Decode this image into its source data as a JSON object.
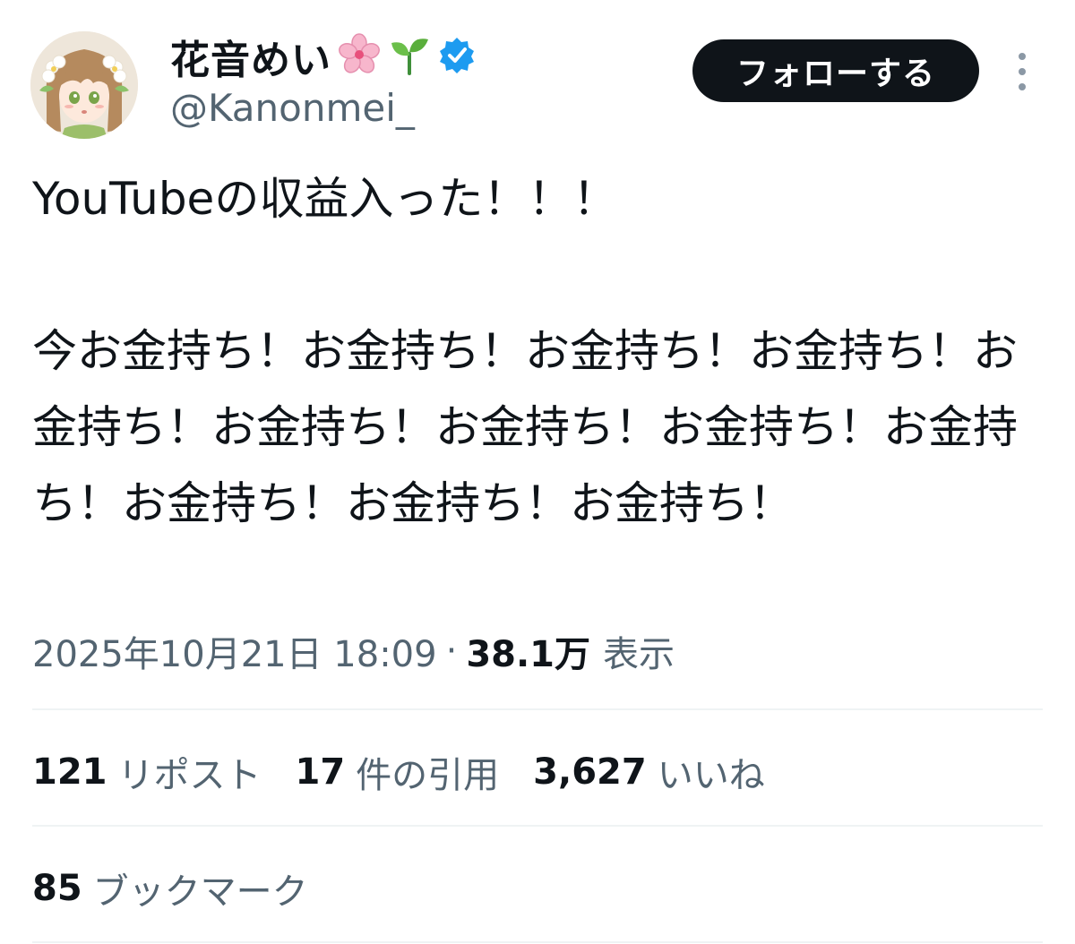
{
  "author": {
    "display_name": "花音めい",
    "handle": "@Kanonmei_",
    "emoji_icons": [
      "cherry-blossom-icon",
      "seedling-icon"
    ],
    "verified": true,
    "verified_color": "#1d9bf0"
  },
  "follow_button": {
    "label": "フォローする"
  },
  "tweet": {
    "text": "YouTubeの収益入った！！！\n\n今お金持ち！お金持ち！お金持ち！お金持ち！お金持ち！お金持ち！お金持ち！お金持ち！お金持ち！お金持ち！お金持ち！お金持ち！"
  },
  "meta": {
    "timestamp": "2025年10月21日 18:09",
    "separator": "·",
    "views_count": "38.1万",
    "views_label": "表示"
  },
  "stats": {
    "reposts": {
      "count": "121",
      "label": "リポスト"
    },
    "quotes": {
      "count": "17",
      "label": "件の引用"
    },
    "likes": {
      "count": "3,627",
      "label": "いいね"
    },
    "bookmarks": {
      "count": "85",
      "label": "ブックマーク"
    }
  },
  "colors": {
    "text_primary": "#0f1419",
    "text_secondary": "#536471",
    "divider": "#eff3f4",
    "follow_button_bg": "#0f1419"
  }
}
